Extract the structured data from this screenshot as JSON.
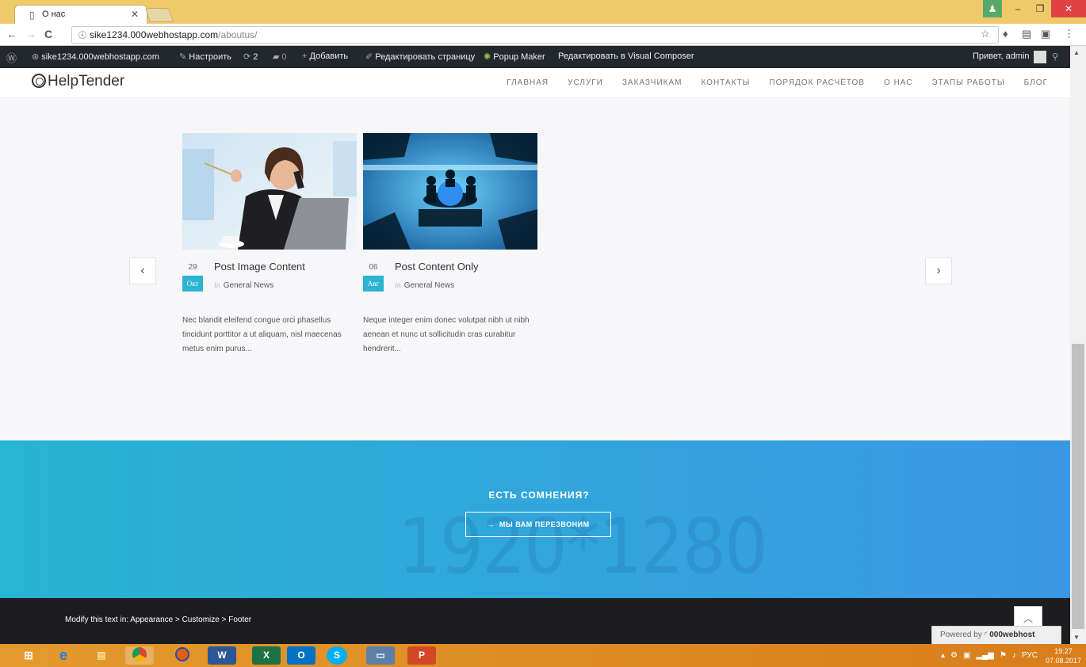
{
  "browser": {
    "tab_title": "О нас",
    "url_host": "sike1234.000webhostapp.com",
    "url_path": "/aboutus/"
  },
  "wpbar": {
    "site": "sike1234.000webhostapp.com",
    "customize": "Настроить",
    "updates": "2",
    "comments": "0",
    "add": "Добавить",
    "edit": "Редактировать страницу",
    "popup": "Popup Maker",
    "vc": "Редактировать в Visual Composer",
    "greeting": "Привет, admin"
  },
  "site": {
    "logo": "HelpTender",
    "nav": [
      "ГЛАВНАЯ",
      "УСЛУГИ",
      "ЗАКАЗЧИКАМ",
      "КОНТАКТЫ",
      "ПОРЯДОК РАСЧЁТОВ",
      "О НАС",
      "ЭТАПЫ РАБОТЫ",
      "БЛОГ"
    ]
  },
  "posts": [
    {
      "day": "29",
      "month": "Окт",
      "title": "Post Image Content",
      "cat_prefix": "in",
      "category": "General News",
      "excerpt": "Nec blandit eleifend congue orci phasellus tincidunt porttitor a ut aliquam, nisl maecenas metus enim purus..."
    },
    {
      "day": "06",
      "month": "Авг",
      "title": "Post Content Only",
      "cat_prefix": "in",
      "category": "General News",
      "excerpt": "Neque integer enim donec volutpat nibh ut nibh aenean et nunc ut sollicitudin cras curabitur hendrerit..."
    }
  ],
  "cta": {
    "heading": "ЕСТЬ СОМНЕНИЯ?",
    "button": "МЫ ВАМ ПЕРЕЗВОНИМ",
    "watermark": "1920*1280"
  },
  "footer": {
    "text": "Modify this text in: Appearance > Customize > Footer",
    "powered_prefix": "Powered by",
    "powered_brand": "000webhost"
  },
  "taskbar": {
    "lang": "РУС",
    "time": "19:27",
    "date": "07.08.2017"
  },
  "colors": {
    "accent": "#2bb4cf",
    "wpbar": "#23282d",
    "taskbar": "#e39a2e"
  }
}
